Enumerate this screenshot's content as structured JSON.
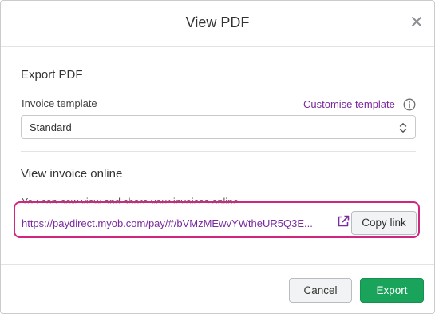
{
  "dialog": {
    "title": "View PDF",
    "close_icon": "close-icon"
  },
  "export_pdf": {
    "heading": "Export PDF",
    "template_label": "Invoice template",
    "customise_link": "Customise template",
    "info_icon": "info-icon",
    "template_value": "Standard",
    "select_icon": "updown-chevron-icon"
  },
  "view_online": {
    "heading": "View invoice online",
    "share_text": "You can now view and share your invoices online",
    "url": "https://paydirect.myob.com/pay/#/bVMzMEwvYWtheUR5Q3E...",
    "external_icon": "external-link-icon",
    "copy_button": "Copy link"
  },
  "footer": {
    "cancel_label": "Cancel",
    "export_label": "Export"
  },
  "colors": {
    "accent_link": "#7b2a9f",
    "highlight_border": "#d1267d",
    "primary_button": "#1aa35a"
  }
}
